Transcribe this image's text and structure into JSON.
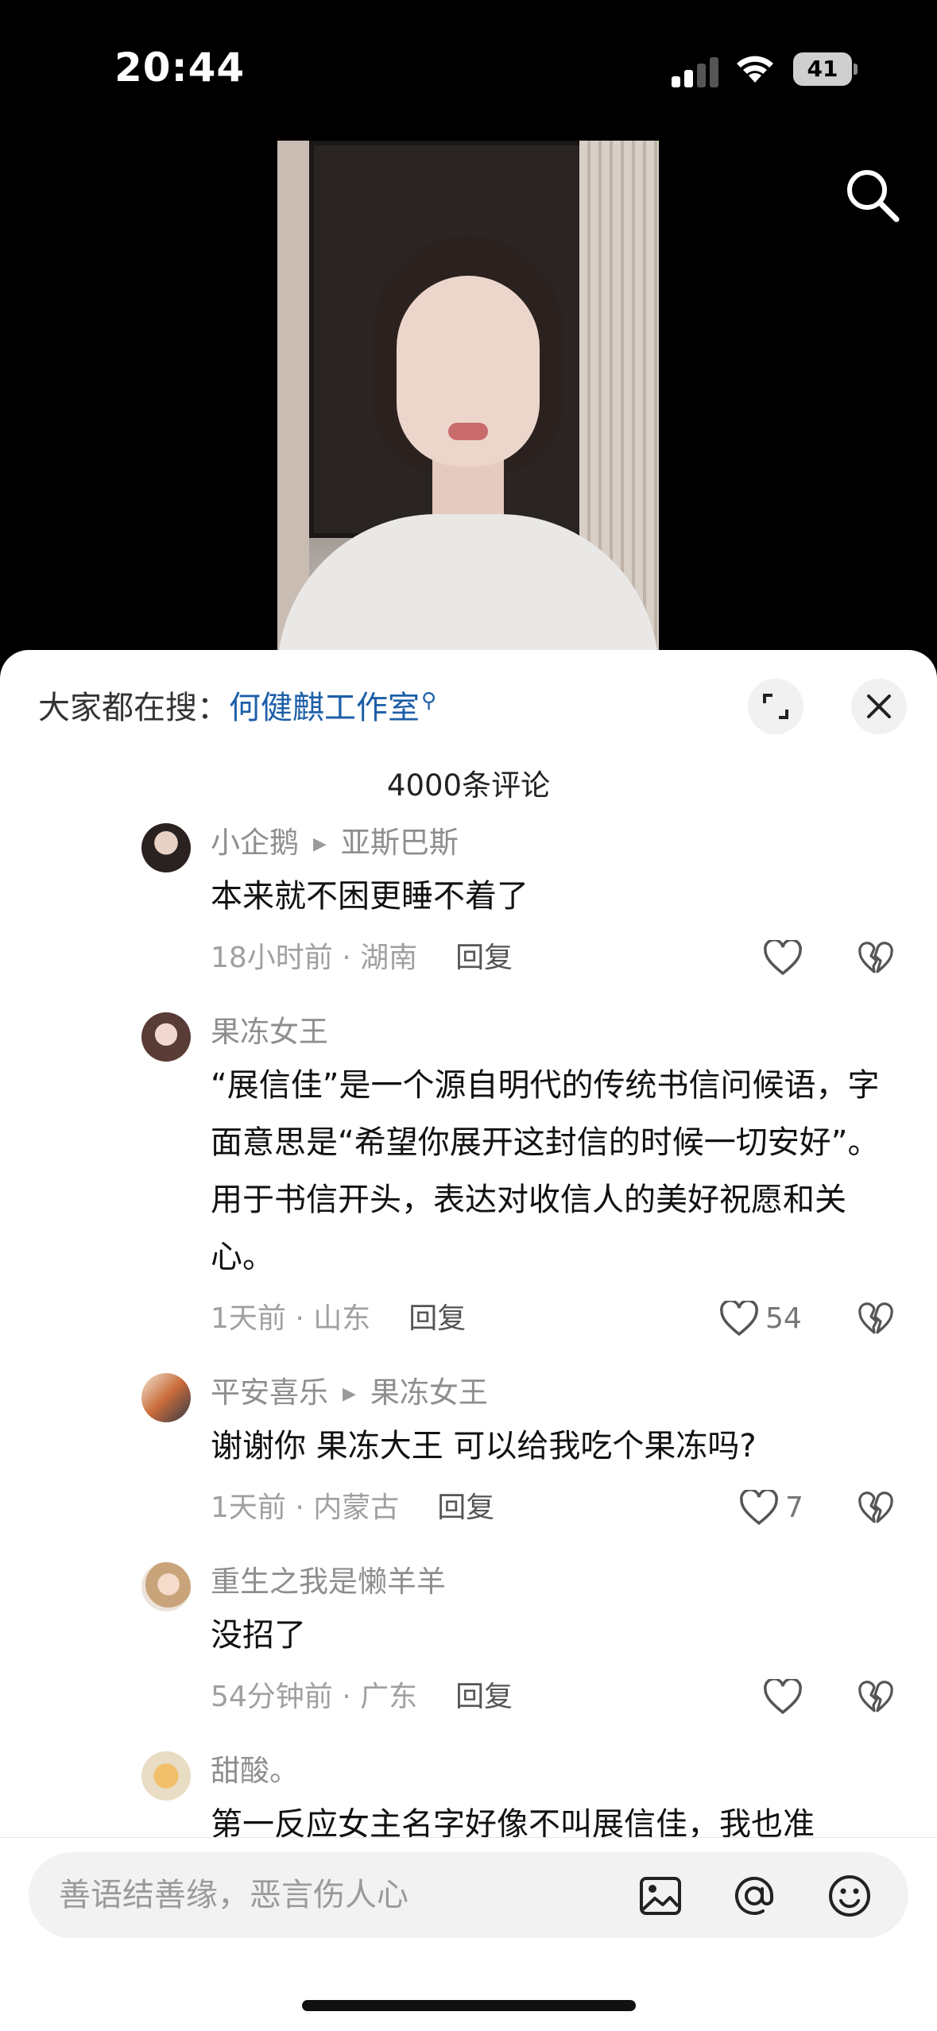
{
  "status_bar": {
    "time": "20:44",
    "battery": "41"
  },
  "trending": {
    "prefix": "大家都在搜：",
    "query": "何健麒工作室"
  },
  "comment_count": "4000条评论",
  "comments": [
    {
      "user": "小企鹅",
      "reply_to": "亚斯巴斯",
      "text": "本来就不困更睡不着了",
      "time_location": "18小时前 · 湖南",
      "reply_label": "回复",
      "likes": ""
    },
    {
      "user": "果冻女王",
      "reply_to": "",
      "text": "“展信佳”是一个源自明代的传统书信问候语，字面意思是“希望你展开这封信的时候一切安好”。用于书信开头，表达对收信人的美好祝愿和关心。",
      "time_location": "1天前 · 山东",
      "reply_label": "回复",
      "likes": "54"
    },
    {
      "user": "平安喜乐",
      "reply_to": "果冻女王",
      "text": "谢谢你 果冻大王  可以给我吃个果冻吗?",
      "time_location": "1天前 · 内蒙古",
      "reply_label": "回复",
      "likes": "7"
    },
    {
      "user": "重生之我是懒羊羊",
      "reply_to": "",
      "text": "没招了",
      "time_location": "54分钟前 · 广东",
      "reply_label": "回复",
      "likes": ""
    },
    {
      "user": "甜酸。",
      "reply_to": "",
      "text": "第一反应女主名字好像不叫展信佳，我也准",
      "time_location": "",
      "reply_label": "",
      "likes": ""
    }
  ],
  "input": {
    "placeholder": "善语结善缘，恶言伤人心"
  },
  "icons": [
    "search-icon",
    "expand-icon",
    "close-icon",
    "heart-icon",
    "broken-heart-icon",
    "image-icon",
    "at-icon",
    "emoji-icon"
  ],
  "colors": {
    "link": "#1d5fa8",
    "background": "#000000",
    "sheet": "#ffffff"
  }
}
